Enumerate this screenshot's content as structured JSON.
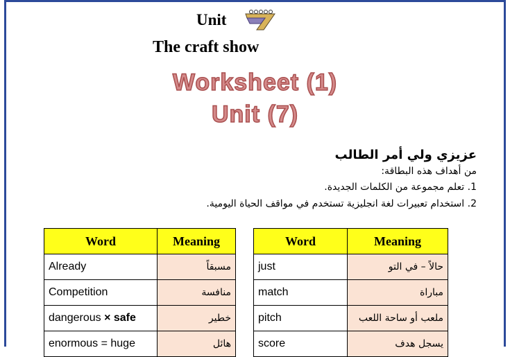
{
  "header": {
    "unit_word": "Unit",
    "title": "The  craft show",
    "worksheet": "Worksheet (1)",
    "unit_number": "Unit (7)"
  },
  "intro": {
    "heading": "عزيزي ولي أمر الطالب",
    "subheading": "من أهداف هذه البطاقة:",
    "goals": [
      "1. تعلم مجموعة من الكلمات الجديدة.",
      "2. استخدام تعبيرات لغة انجليزية تستخدم في مواقف الحياة اليومية."
    ]
  },
  "tables": {
    "word_header": "Word",
    "meaning_header": "Meaning",
    "left": [
      {
        "word": "Already",
        "meaning": "مسبقاً"
      },
      {
        "word": "Competition",
        "meaning": "منافسة"
      },
      {
        "word": "dangerous",
        "mark": "×",
        "antonym": "safe",
        "meaning": "خطير"
      },
      {
        "word": "enormous = huge",
        "meaning": "هائل"
      }
    ],
    "right": [
      {
        "word": "just",
        "meaning": "حالاً – في التو"
      },
      {
        "word": "match",
        "meaning": "مباراة"
      },
      {
        "word": "pitch",
        "meaning": "ملعب أو ساحة اللعب"
      },
      {
        "word": "score",
        "meaning": "يسجل هدف"
      }
    ]
  },
  "colors": {
    "border": "#2c4a9a",
    "header_fill": "#ffff1a",
    "meaning_fill": "#fbe3d4",
    "worksheet_text": "#d48a8a"
  }
}
